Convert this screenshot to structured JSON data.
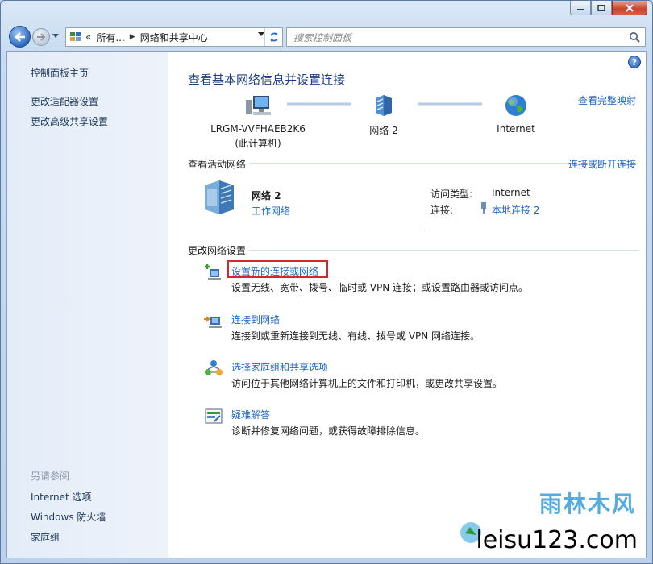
{
  "window": {
    "caption_buttons": [
      "minimize",
      "maximize",
      "close"
    ]
  },
  "navbar": {
    "address_segments": [
      "所有...",
      "网络和共享中心"
    ],
    "address_prefix": "«",
    "search_placeholder": "搜索控制面板"
  },
  "sidebar": {
    "home": "控制面板主页",
    "links": [
      "更改适配器设置",
      "更改高级共享设置"
    ],
    "see_also_heading": "另请参阅",
    "see_also": [
      "Internet 选项",
      "Windows 防火墙",
      "家庭组"
    ]
  },
  "main": {
    "title": "查看基本网络信息并设置连接",
    "full_map_link": "查看完整映射",
    "map": {
      "computer_name": "LRGM-VVFHAEB2K6",
      "computer_sub": "(此计算机)",
      "network": "网络  2",
      "internet": "Internet"
    },
    "active_networks": {
      "heading": "查看活动网络",
      "connect_link": "连接或断开连接",
      "name": "网络  2",
      "type": "工作网络",
      "access_label": "访问类型:",
      "access_value": "Internet",
      "conn_label": "连接:",
      "conn_value": "本地连接 2"
    },
    "change_settings": {
      "heading": "更改网络设置",
      "tasks": [
        {
          "link": "设置新的连接或网络",
          "desc": "设置无线、宽带、拨号、临时或 VPN 连接；或设置路由器或访问点。"
        },
        {
          "link": "连接到网络",
          "desc": "连接到或重新连接到无线、有线、拨号或 VPN 网络连接。"
        },
        {
          "link": "选择家庭组和共享选项",
          "desc": "访问位于其他网络计算机上的文件和打印机，或更改共享设置。"
        },
        {
          "link": "疑难解答",
          "desc": "诊断并修复网络问题，或获得故障排除信息。"
        }
      ]
    }
  },
  "watermark": {
    "top": "雨林木风",
    "bottom": "leisu123.com"
  },
  "colors": {
    "link": "#1f66c2",
    "title": "#1e3e84",
    "highlight": "#d8262a"
  }
}
